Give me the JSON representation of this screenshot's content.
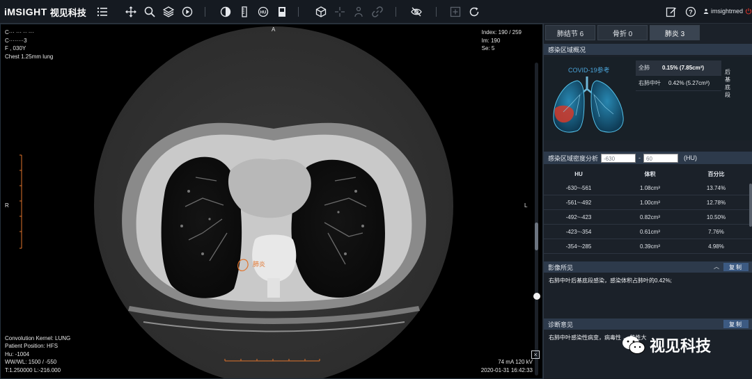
{
  "app": {
    "brand": "iMSIGHT",
    "brand_cn": "视见科技",
    "user_name": "imsightmed"
  },
  "toolbar": {
    "icons": [
      "menu-icon",
      "pan-icon",
      "zoom-icon",
      "layers-icon",
      "play-icon",
      "contrast-icon",
      "ruler-icon",
      "hu-icon",
      "document-icon",
      "cube-icon",
      "crosshair-icon",
      "anatomy-icon",
      "link-icon",
      "hide-icon",
      "add-icon",
      "refresh-icon",
      "edit-icon",
      "help-icon",
      "power-icon"
    ]
  },
  "viewer": {
    "top_left": [
      "C··· ··· ·· ···",
      "C········3",
      "F , 030Y",
      "Chest 1.25mm lung"
    ],
    "top_right": [
      "Index: 190 / 259",
      "Im: 190",
      "Se: 5"
    ],
    "bottom_left": [
      "Convolution Kernel: LUNG",
      "Patient Position: HFS",
      "Hu: -1004",
      "WW/WL: 1500 / -550",
      "T:1.250000 L:-216.000"
    ],
    "bottom_right": [
      "74 mA 120 kV",
      "2020-01-31 16:42:33"
    ],
    "orientation": {
      "top": "A",
      "left": "R",
      "right": "L"
    },
    "lesion_label": "肺炎"
  },
  "panel": {
    "tabs": [
      {
        "label": "肺结节 6",
        "active": false
      },
      {
        "label": "骨折 0",
        "active": false
      },
      {
        "label": "肺炎 3",
        "active": true
      }
    ],
    "overview_title": "感染区域概况",
    "covid_label": "COVID-19参考",
    "stats": [
      {
        "key": "全肺",
        "value": "0.15% (7.85cm³)",
        "extra": ""
      },
      {
        "key": "右肺中叶",
        "value": "0.42% (5.27cm³)",
        "extra": "后基底段"
      }
    ],
    "density_title": "感染区域密度分析",
    "hu_min": "-630",
    "hu_max": "60",
    "hu_unit": "(HU)",
    "hist_headers": [
      "HU",
      "体积",
      "百分比"
    ],
    "hist_rows": [
      [
        "-630~-561",
        "1.08cm³",
        "13.74%"
      ],
      [
        "-561~-492",
        "1.00cm³",
        "12.78%"
      ],
      [
        "-492~-423",
        "0.82cm³",
        "10.50%"
      ],
      [
        "-423~-354",
        "0.61cm³",
        "7.76%"
      ],
      [
        "-354~-285",
        "0.39cm³",
        "4.98%"
      ]
    ],
    "findings_title": "影像所见",
    "findings_text": "右肺中叶后基底段感染，感染体积占肺叶的0.42%;",
    "diagnosis_title": "诊断意见",
    "diagnosis_text": "右肺中叶感染性病变，病毒性      ，      能性大",
    "copy_label": "复制"
  },
  "watermark": "视见科技",
  "colors": {
    "accent": "#3c5a82",
    "lesion": "#e0732c",
    "header": "#2d3a4b"
  }
}
